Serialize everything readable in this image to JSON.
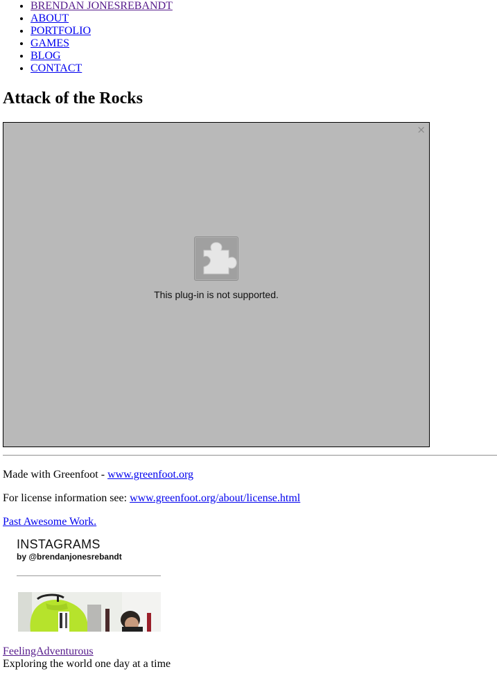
{
  "nav": {
    "items": [
      {
        "label": "BRENDAN JONESREBANDT",
        "visited": true
      },
      {
        "label": "ABOUT",
        "visited": false
      },
      {
        "label": "PORTFOLIO",
        "visited": false
      },
      {
        "label": "GAMES",
        "visited": false
      },
      {
        "label": "BLOG",
        "visited": false
      },
      {
        "label": "CONTACT",
        "visited": false
      }
    ]
  },
  "page_title": "Attack of the Rocks",
  "plugin": {
    "message": "This plug-in is not supported.",
    "close_glyph": "×",
    "icon": "puzzle-piece-icon",
    "background_color": "#b9b9b9"
  },
  "footer": {
    "made_with_prefix": "Made with Greenfoot - ",
    "greenfoot_link": "www.greenfoot.org",
    "license_prefix": "For license information see: ",
    "license_link": "www.greenfoot.org/about/license.html",
    "past_work_link": "Past Awesome Work."
  },
  "instagram": {
    "title": "INSTAGRAMS",
    "subtitle": "by @brendanjonesrebandt"
  },
  "blog": {
    "name_link": "FeelingAdventurous",
    "tagline": "Exploring the world one day at a time"
  },
  "colors": {
    "link": "#0000ee",
    "visited_link": "#551a8b"
  }
}
